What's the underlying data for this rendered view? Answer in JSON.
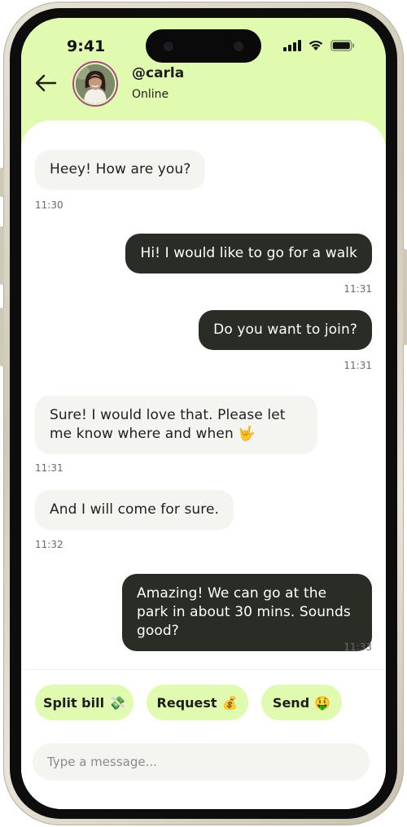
{
  "status_bar": {
    "time": "9:41"
  },
  "header": {
    "username": "@carla",
    "presence": "Online"
  },
  "messages": [
    {
      "direction": "in",
      "text": "Heey! How are you?",
      "time": "11:30"
    },
    {
      "direction": "out",
      "text": "Hi! I would like to go for a walk",
      "time": "11:31"
    },
    {
      "direction": "out",
      "text": "Do you want to join?",
      "time": "11:31"
    },
    {
      "direction": "in",
      "text": "Sure! I would love that. Please let me know where and when 🤟",
      "time": "11:31"
    },
    {
      "direction": "in",
      "text": "And I will come for sure.",
      "time": "11:32"
    },
    {
      "direction": "out",
      "text": "Amazing! We can go at the park in about 30 mins. Sounds good?",
      "time": "11:33"
    }
  ],
  "quick_actions": [
    {
      "label": "Split bill",
      "emoji": "💸"
    },
    {
      "label": "Request",
      "emoji": "💰"
    },
    {
      "label": "Send",
      "emoji": "🤑"
    }
  ],
  "composer": {
    "placeholder": "Type a message..."
  },
  "colors": {
    "accent": "#e0fbb0",
    "outgoing_bubble": "#2a2c26",
    "incoming_bubble": "#f4f4f1",
    "phone_frame": "#cfc8b8"
  },
  "icons": [
    "back-arrow-icon",
    "signal-icon",
    "wifi-icon",
    "battery-icon"
  ]
}
